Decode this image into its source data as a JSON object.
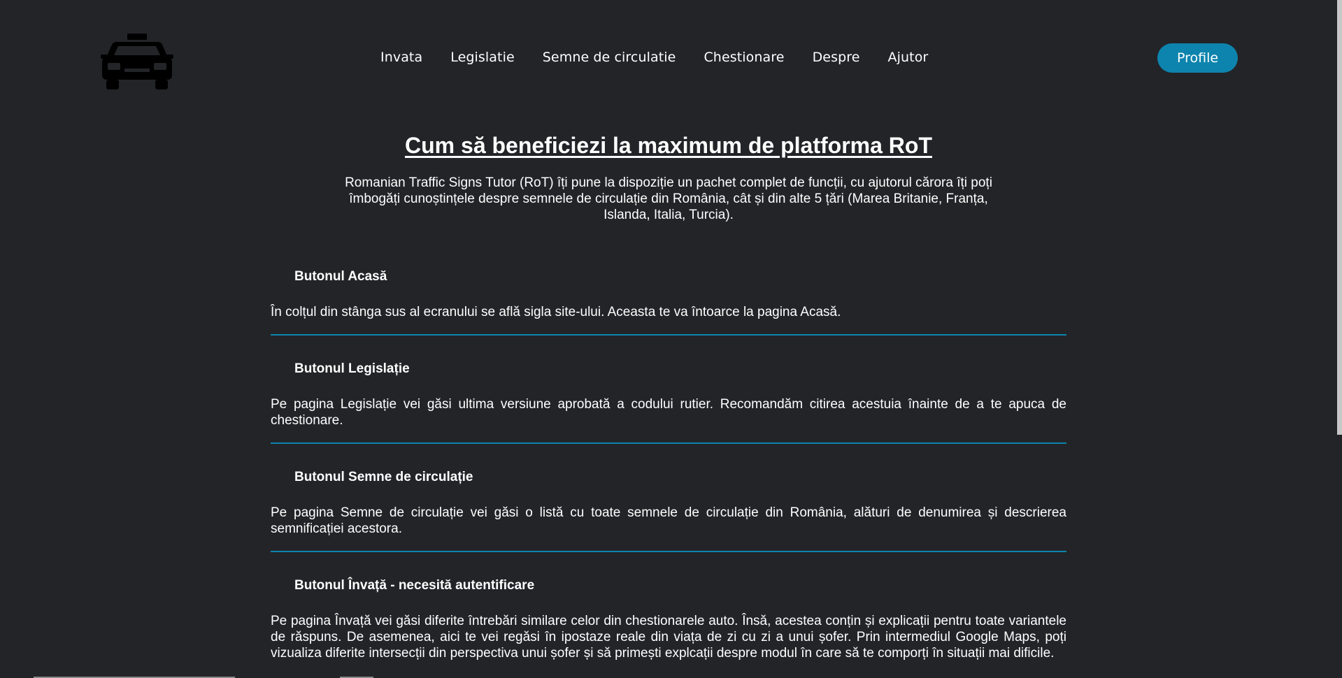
{
  "nav": {
    "items": [
      "Invata",
      "Legislatie",
      "Semne de circulatie",
      "Chestionare",
      "Despre",
      "Ajutor"
    ],
    "profile_label": "Profile"
  },
  "main": {
    "title": "Cum să beneficiezi la maximum de platforma RoT",
    "intro": "Romanian Traffic Signs Tutor (RoT) îți pune la dispoziție un pachet complet de funcții, cu ajutorul cărora îți poți îmbogăți cunoștințele despre semnele de circulație din România, cât și din alte 5 țări (Marea Britanie, Franța, Islanda, Italia, Turcia).",
    "sections": [
      {
        "heading": "Butonul Acasă",
        "text": "În colțul din stânga sus al ecranului se află sigla site-ului. Aceasta te va întoarce la pagina Acasă."
      },
      {
        "heading": "Butonul Legislație",
        "text": "Pe pagina Legislație vei găsi ultima versiune aprobată a codului rutier. Recomandăm citirea acestuia înainte de a te apuca de chestionare."
      },
      {
        "heading": "Butonul Semne de circulație",
        "text": "Pe pagina Semne de circulație vei găsi o listă cu toate semnele de circulație din România, alături de denumirea și descrierea semnificației acestora."
      },
      {
        "heading": "Butonul Învață - necesită autentificare",
        "text": "Pe pagina Învață vei găsi diferite întrebări similare celor din chestionarele auto. Însă, acestea conțin și explicații pentru toate variantele de răspuns. De asemenea, aici te vei regăsi în ipostaze reale din viața de zi cu zi a unui șofer. Prin intermediul Google Maps, poți vizualiza diferite intersecții din perspectiva unui șofer și să primești explcații despre modul în care să te comporți în situații mai dificile."
      }
    ]
  },
  "colors": {
    "background": "#232428",
    "accent": "#0d84ad",
    "text": "#ffffff",
    "logo": "#000000"
  },
  "icons": {
    "logo": "taxi-car-icon"
  }
}
